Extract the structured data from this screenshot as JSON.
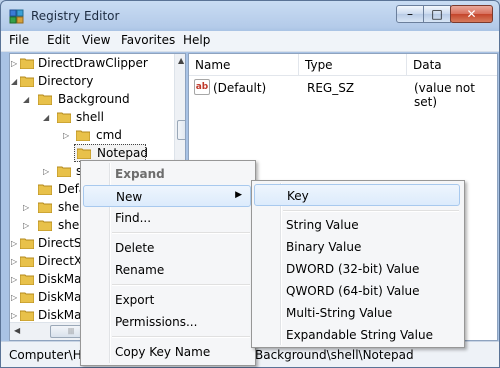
{
  "window": {
    "title": "Registry Editor",
    "controls": {
      "minimize": "–",
      "maximize": "□",
      "close": "✕"
    }
  },
  "menubar": [
    "File",
    "Edit",
    "View",
    "Favorites",
    "Help"
  ],
  "tree": {
    "items": [
      {
        "label": "DirectDrawClipper",
        "expander": "▷"
      },
      {
        "label": "Directory",
        "expander": "◢"
      },
      {
        "label": "Background",
        "expander": "◢"
      },
      {
        "label": "shell",
        "expander": "◢"
      },
      {
        "label": "cmd",
        "expander": "▷"
      },
      {
        "label": "Notepad",
        "expander": ""
      },
      {
        "label": "s",
        "expander": "▷"
      },
      {
        "label": "Defa",
        "expander": ""
      },
      {
        "label": "shel",
        "expander": "▷"
      },
      {
        "label": "shel",
        "expander": "▷"
      },
      {
        "label": "DirectSh",
        "expander": "▷"
      },
      {
        "label": "DirectXF",
        "expander": "▷"
      },
      {
        "label": "DiskMar",
        "expander": "▷"
      },
      {
        "label": "DiskMar",
        "expander": "▷"
      },
      {
        "label": "DiskMar",
        "expander": "▷"
      }
    ]
  },
  "values_pane": {
    "columns": [
      "Name",
      "Type",
      "Data"
    ],
    "rows": [
      {
        "name": "(Default)",
        "type": "REG_SZ",
        "data": "(value not set)",
        "icon": "ab-string-icon",
        "icon_text": "ab"
      }
    ]
  },
  "statusbar": {
    "left_text": "Computer\\HI",
    "right_text": "Background\\shell\\Notepad"
  },
  "context_menu": {
    "items": [
      "Expand",
      "New",
      "Find...",
      "Delete",
      "Rename",
      "Export",
      "Permissions...",
      "Copy Key Name"
    ],
    "submenu_arrow": "▶"
  },
  "new_submenu": {
    "items": [
      "Key",
      "String Value",
      "Binary Value",
      "DWORD (32-bit) Value",
      "QWORD (64-bit) Value",
      "Multi-String Value",
      "Expandable String Value"
    ]
  },
  "colors": {
    "accent": "#a8c9ee",
    "folder": "#e8c14a",
    "selection": "#dcebfc"
  }
}
